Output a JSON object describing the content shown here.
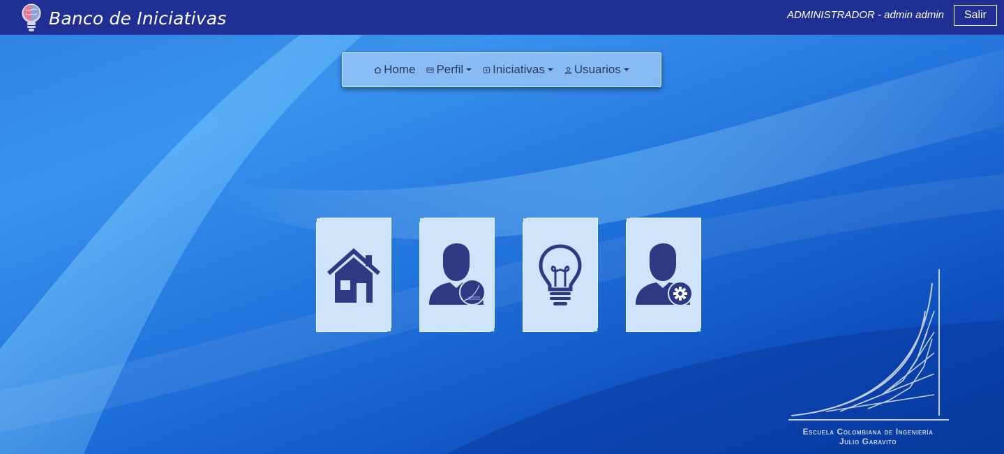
{
  "header": {
    "app_title": "Banco de Iniciativas",
    "user_label": "ADMINISTRADOR - admin admin",
    "logout_label": "Salir"
  },
  "nav": {
    "items": [
      {
        "label": "Home",
        "icon": "home-icon",
        "has_dropdown": false
      },
      {
        "label": "Perfil",
        "icon": "profile-card-icon",
        "has_dropdown": true
      },
      {
        "label": "Iniciativas",
        "icon": "initiatives-icon",
        "has_dropdown": true
      },
      {
        "label": "Usuarios",
        "icon": "user-icon",
        "has_dropdown": true
      }
    ]
  },
  "tiles": [
    {
      "icon": "house-icon"
    },
    {
      "icon": "user-profile-icon"
    },
    {
      "icon": "lightbulb-icon"
    },
    {
      "icon": "user-settings-icon"
    }
  ],
  "university": {
    "line1": "Escuela Colombiana de Ingeniería",
    "line2": "Julio Garavito"
  },
  "colors": {
    "header_bg": "#1f2f94",
    "tile_bg": "#cfe3fa",
    "icon_color": "#2b3a82",
    "nav_bg": "#96c3f5"
  }
}
